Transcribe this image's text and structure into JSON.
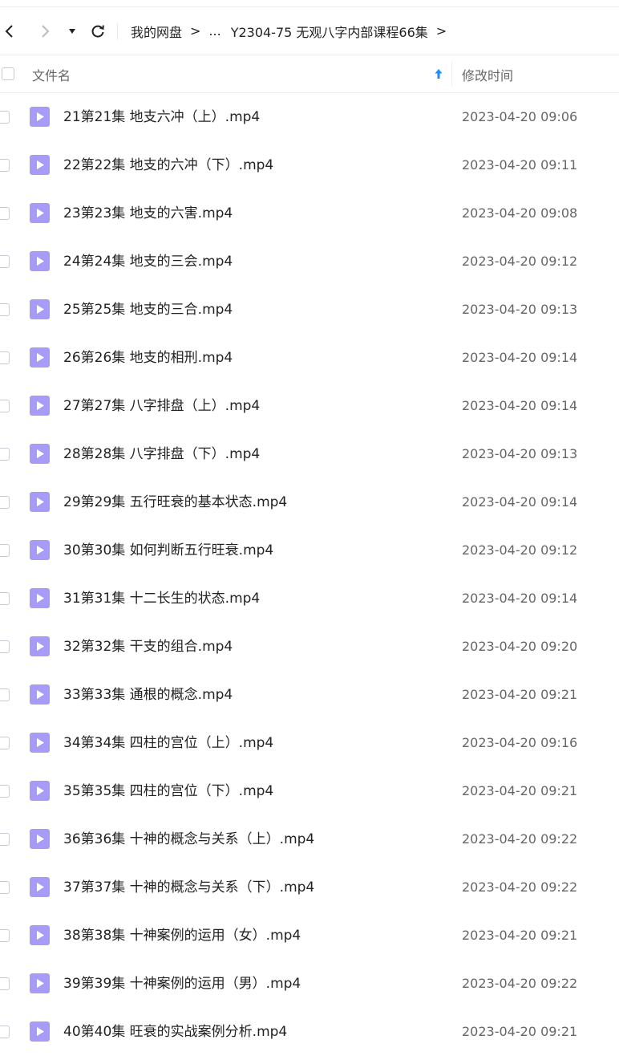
{
  "breadcrumb": {
    "root": "我的网盘",
    "separator": ">",
    "ellipsis": "...",
    "current": "Y2304-75 无观八字内部课程66集"
  },
  "columns": {
    "name": "文件名",
    "modified": "修改时间",
    "sort_icon": "arrow-up-icon"
  },
  "colors": {
    "accent": "#1a8cff",
    "video_icon_bg": "#a69cf7",
    "divider": "#eceef2"
  },
  "files": [
    {
      "name": "21第21集 地支六冲（上）.mp4",
      "time": "2023-04-20 09:06"
    },
    {
      "name": "22第22集 地支的六冲（下）.mp4",
      "time": "2023-04-20 09:11"
    },
    {
      "name": "23第23集 地支的六害.mp4",
      "time": "2023-04-20 09:08"
    },
    {
      "name": "24第24集 地支的三会.mp4",
      "time": "2023-04-20 09:12"
    },
    {
      "name": "25第25集 地支的三合.mp4",
      "time": "2023-04-20 09:13"
    },
    {
      "name": "26第26集 地支的相刑.mp4",
      "time": "2023-04-20 09:14"
    },
    {
      "name": "27第27集 八字排盘（上）.mp4",
      "time": "2023-04-20 09:14"
    },
    {
      "name": "28第28集 八字排盘（下）.mp4",
      "time": "2023-04-20 09:13"
    },
    {
      "name": "29第29集 五行旺衰的基本状态.mp4",
      "time": "2023-04-20 09:14"
    },
    {
      "name": "30第30集 如何判断五行旺衰.mp4",
      "time": "2023-04-20 09:12"
    },
    {
      "name": "31第31集 十二长生的状态.mp4",
      "time": "2023-04-20 09:14"
    },
    {
      "name": "32第32集 干支的组合.mp4",
      "time": "2023-04-20 09:20"
    },
    {
      "name": "33第33集 通根的概念.mp4",
      "time": "2023-04-20 09:21"
    },
    {
      "name": "34第34集 四柱的宫位（上）.mp4",
      "time": "2023-04-20 09:16"
    },
    {
      "name": "35第35集 四柱的宫位（下）.mp4",
      "time": "2023-04-20 09:21"
    },
    {
      "name": "36第36集 十神的概念与关系（上）.mp4",
      "time": "2023-04-20 09:22"
    },
    {
      "name": "37第37集 十神的概念与关系（下）.mp4",
      "time": "2023-04-20 09:22"
    },
    {
      "name": "38第38集 十神案例的运用（女）.mp4",
      "time": "2023-04-20 09:21"
    },
    {
      "name": "39第39集 十神案例的运用（男）.mp4",
      "time": "2023-04-20 09:22"
    },
    {
      "name": "40第40集 旺衰的实战案例分析.mp4",
      "time": "2023-04-20 09:21"
    }
  ]
}
